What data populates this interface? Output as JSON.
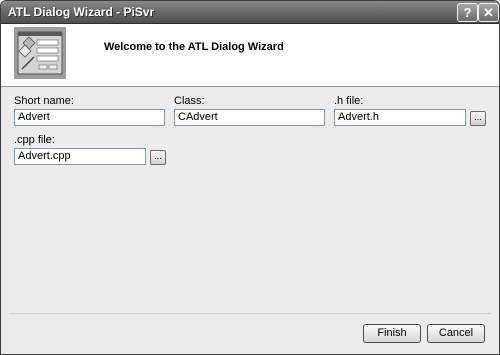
{
  "window": {
    "title": "ATL Dialog Wizard - PiSvr",
    "help_label": "?",
    "close_label": "✕"
  },
  "header": {
    "title": "Welcome to the ATL Dialog Wizard"
  },
  "form": {
    "short_name": {
      "label": "Short name:",
      "value": "Advert"
    },
    "class": {
      "label": "Class:",
      "value": "CAdvert"
    },
    "h_file": {
      "label": ".h file:",
      "value": "Advert.h",
      "browse_label": "..."
    },
    "cpp_file": {
      "label": ".cpp file:",
      "value": "Advert.cpp",
      "browse_label": "..."
    }
  },
  "footer": {
    "finish_label": "Finish",
    "cancel_label": "Cancel"
  }
}
